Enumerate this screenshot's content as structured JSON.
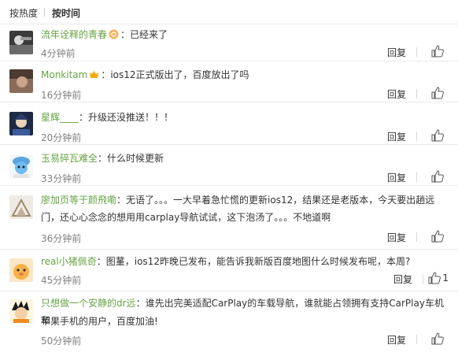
{
  "sort": {
    "hot_label": "按热度",
    "time_label": "按时间"
  },
  "actions": {
    "reply_label": "回复"
  },
  "comments": [
    {
      "user": "流年诠释的青春",
      "text": "：已经来了",
      "time": "4分钟前",
      "likes": ""
    },
    {
      "user": "Monkitam",
      "text": "：ios12正式版出了，百度放出了吗",
      "time": "16分钟前",
      "likes": ""
    },
    {
      "user": "星辉____",
      "text": "：升级还没推送！！！",
      "time": "20分钟前",
      "likes": ""
    },
    {
      "user": "玉易碎瓦难全",
      "text": "：什么时候更新",
      "time": "33分钟前",
      "likes": ""
    },
    {
      "user": "廖加页等于颜飛嘞",
      "text_line1": "：无语了。。。一大早着急忙慌的更新ios12，结果还是老版本，今天要出趟远",
      "text_line2": "门，还心心念念的想用用carplay导航试试，这下泡汤了。。。不地道啊",
      "time": "36分钟前",
      "likes": ""
    },
    {
      "user": "real小猪佩奇",
      "text": "：图蓳，ios12昨晚已发布，能告诉我新版百度地图什么时候发布呢，本周?",
      "time": "45分钟前",
      "likes": "1"
    },
    {
      "user": "只想做一个安静的dr远",
      "text_line1": "：谁先出完美适配CarPlay的车载导航，谁就能占领拥有支持CarPlay车机和",
      "text_line2": "苹果手机的用户，百度加油!",
      "time": "50分钟前",
      "likes": ""
    }
  ]
}
